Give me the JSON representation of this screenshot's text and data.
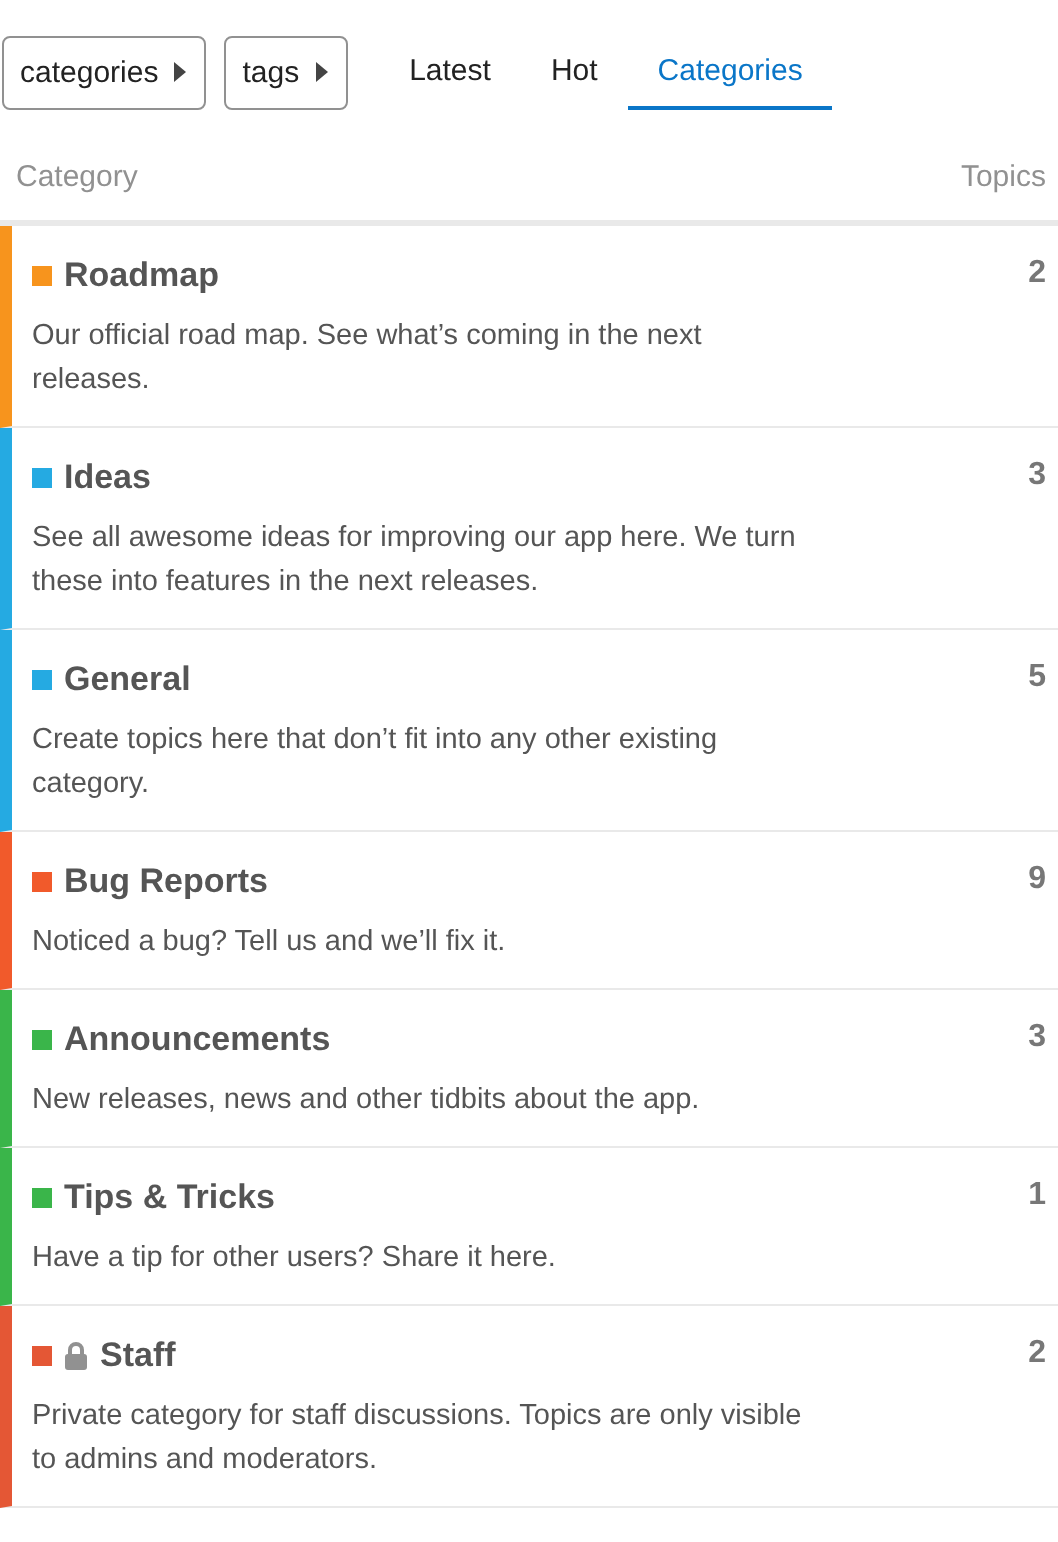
{
  "nav": {
    "dropdowns": [
      {
        "label": "categories"
      },
      {
        "label": "tags"
      }
    ],
    "tabs": [
      {
        "label": "Latest",
        "selected": false
      },
      {
        "label": "Hot",
        "selected": false
      },
      {
        "label": "Categories",
        "selected": true
      }
    ]
  },
  "table": {
    "columns": [
      "Category",
      "Topics"
    ],
    "rows": [
      {
        "name": "Roadmap",
        "color": "#f7941d",
        "private": false,
        "description": "Our official road map. See what’s coming in the next releases.",
        "topics": "2"
      },
      {
        "name": "Ideas",
        "color": "#25aae2",
        "private": false,
        "description": "See all awesome ideas for improving our app here. We turn these into features in the next releases.",
        "topics": "3"
      },
      {
        "name": "General",
        "color": "#25aae2",
        "private": false,
        "description": "Create topics here that don’t fit into any other existing category.",
        "topics": "5"
      },
      {
        "name": "Bug Reports",
        "color": "#f15a2b",
        "private": false,
        "description": "Noticed a bug? Tell us and we’ll fix it.",
        "topics": "9"
      },
      {
        "name": "Announcements",
        "color": "#3ab54a",
        "private": false,
        "description": "New releases, news and other tidbits about the app.",
        "topics": "3"
      },
      {
        "name": "Tips & Tricks",
        "color": "#3ab54a",
        "private": false,
        "description": "Have a tip for other users? Share it here.",
        "topics": "1"
      },
      {
        "name": "Staff",
        "color": "#e45735",
        "private": true,
        "description": "Private category for staff discussions. Topics are only visible to admins and moderators.",
        "topics": "2"
      }
    ]
  }
}
